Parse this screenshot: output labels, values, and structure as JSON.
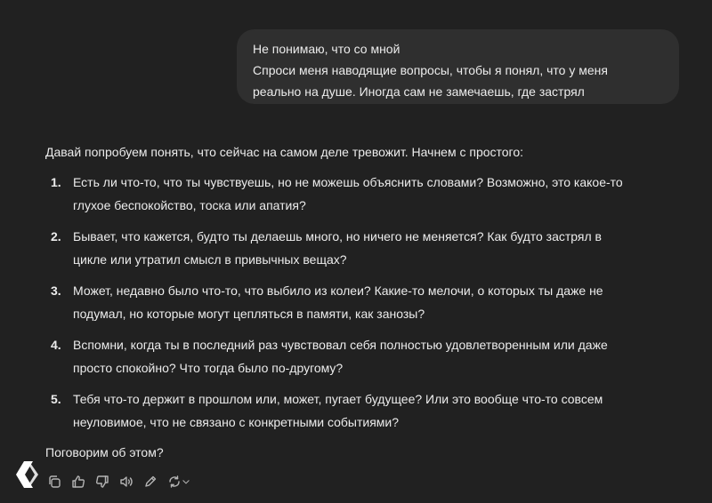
{
  "user_message": {
    "lines": [
      "Не понимаю, что со мной",
      "Спроси меня наводящие вопросы, чтобы я понял, что у меня",
      "реально на душе. Иногда сам не замечаешь, где застрял"
    ]
  },
  "assistant_message": {
    "intro": "Давай попробуем понять, что сейчас на самом деле тревожит. Начнем с простого:",
    "items": [
      {
        "num": "1.",
        "lines": [
          "Есть ли что-то, что ты чувствуешь, но не можешь объяснить словами? Возможно, это какое-то",
          "глухое беспокойство, тоска или апатия?"
        ]
      },
      {
        "num": "2.",
        "lines": [
          "Бывает, что кажется, будто ты делаешь много, но ничего не меняется? Как будто застрял в",
          "цикле или утратил смысл в привычных вещах?"
        ]
      },
      {
        "num": "3.",
        "lines": [
          "Может, недавно было что-то, что выбило из колеи? Какие-то мелочи, о которых ты даже не",
          "подумал, но которые могут цепляться в памяти, как занозы?"
        ]
      },
      {
        "num": "4.",
        "lines": [
          "Вспомни, когда ты в последний раз чувствовал себя полностью удовлетворенным или даже",
          "просто спокойно? Что тогда было по-другому?"
        ]
      },
      {
        "num": "5.",
        "lines": [
          "Тебя что-то держит в прошлом или, может, пугает будущее? Или это вообще что-то совсем",
          "неуловимое, что не связано с конкретными событиями?"
        ]
      }
    ],
    "outro": "Поговорим об этом?"
  },
  "actions": {
    "icons": [
      "copy-icon",
      "thumbs-up-icon",
      "thumbs-down-icon",
      "read-aloud-icon",
      "edit-icon",
      "regenerate-icon",
      "chevron-down-icon"
    ]
  },
  "colors": {
    "background": "#212121",
    "user_bubble": "#2f2f2f",
    "text": "#ececec",
    "icon": "#b4b4b4"
  }
}
